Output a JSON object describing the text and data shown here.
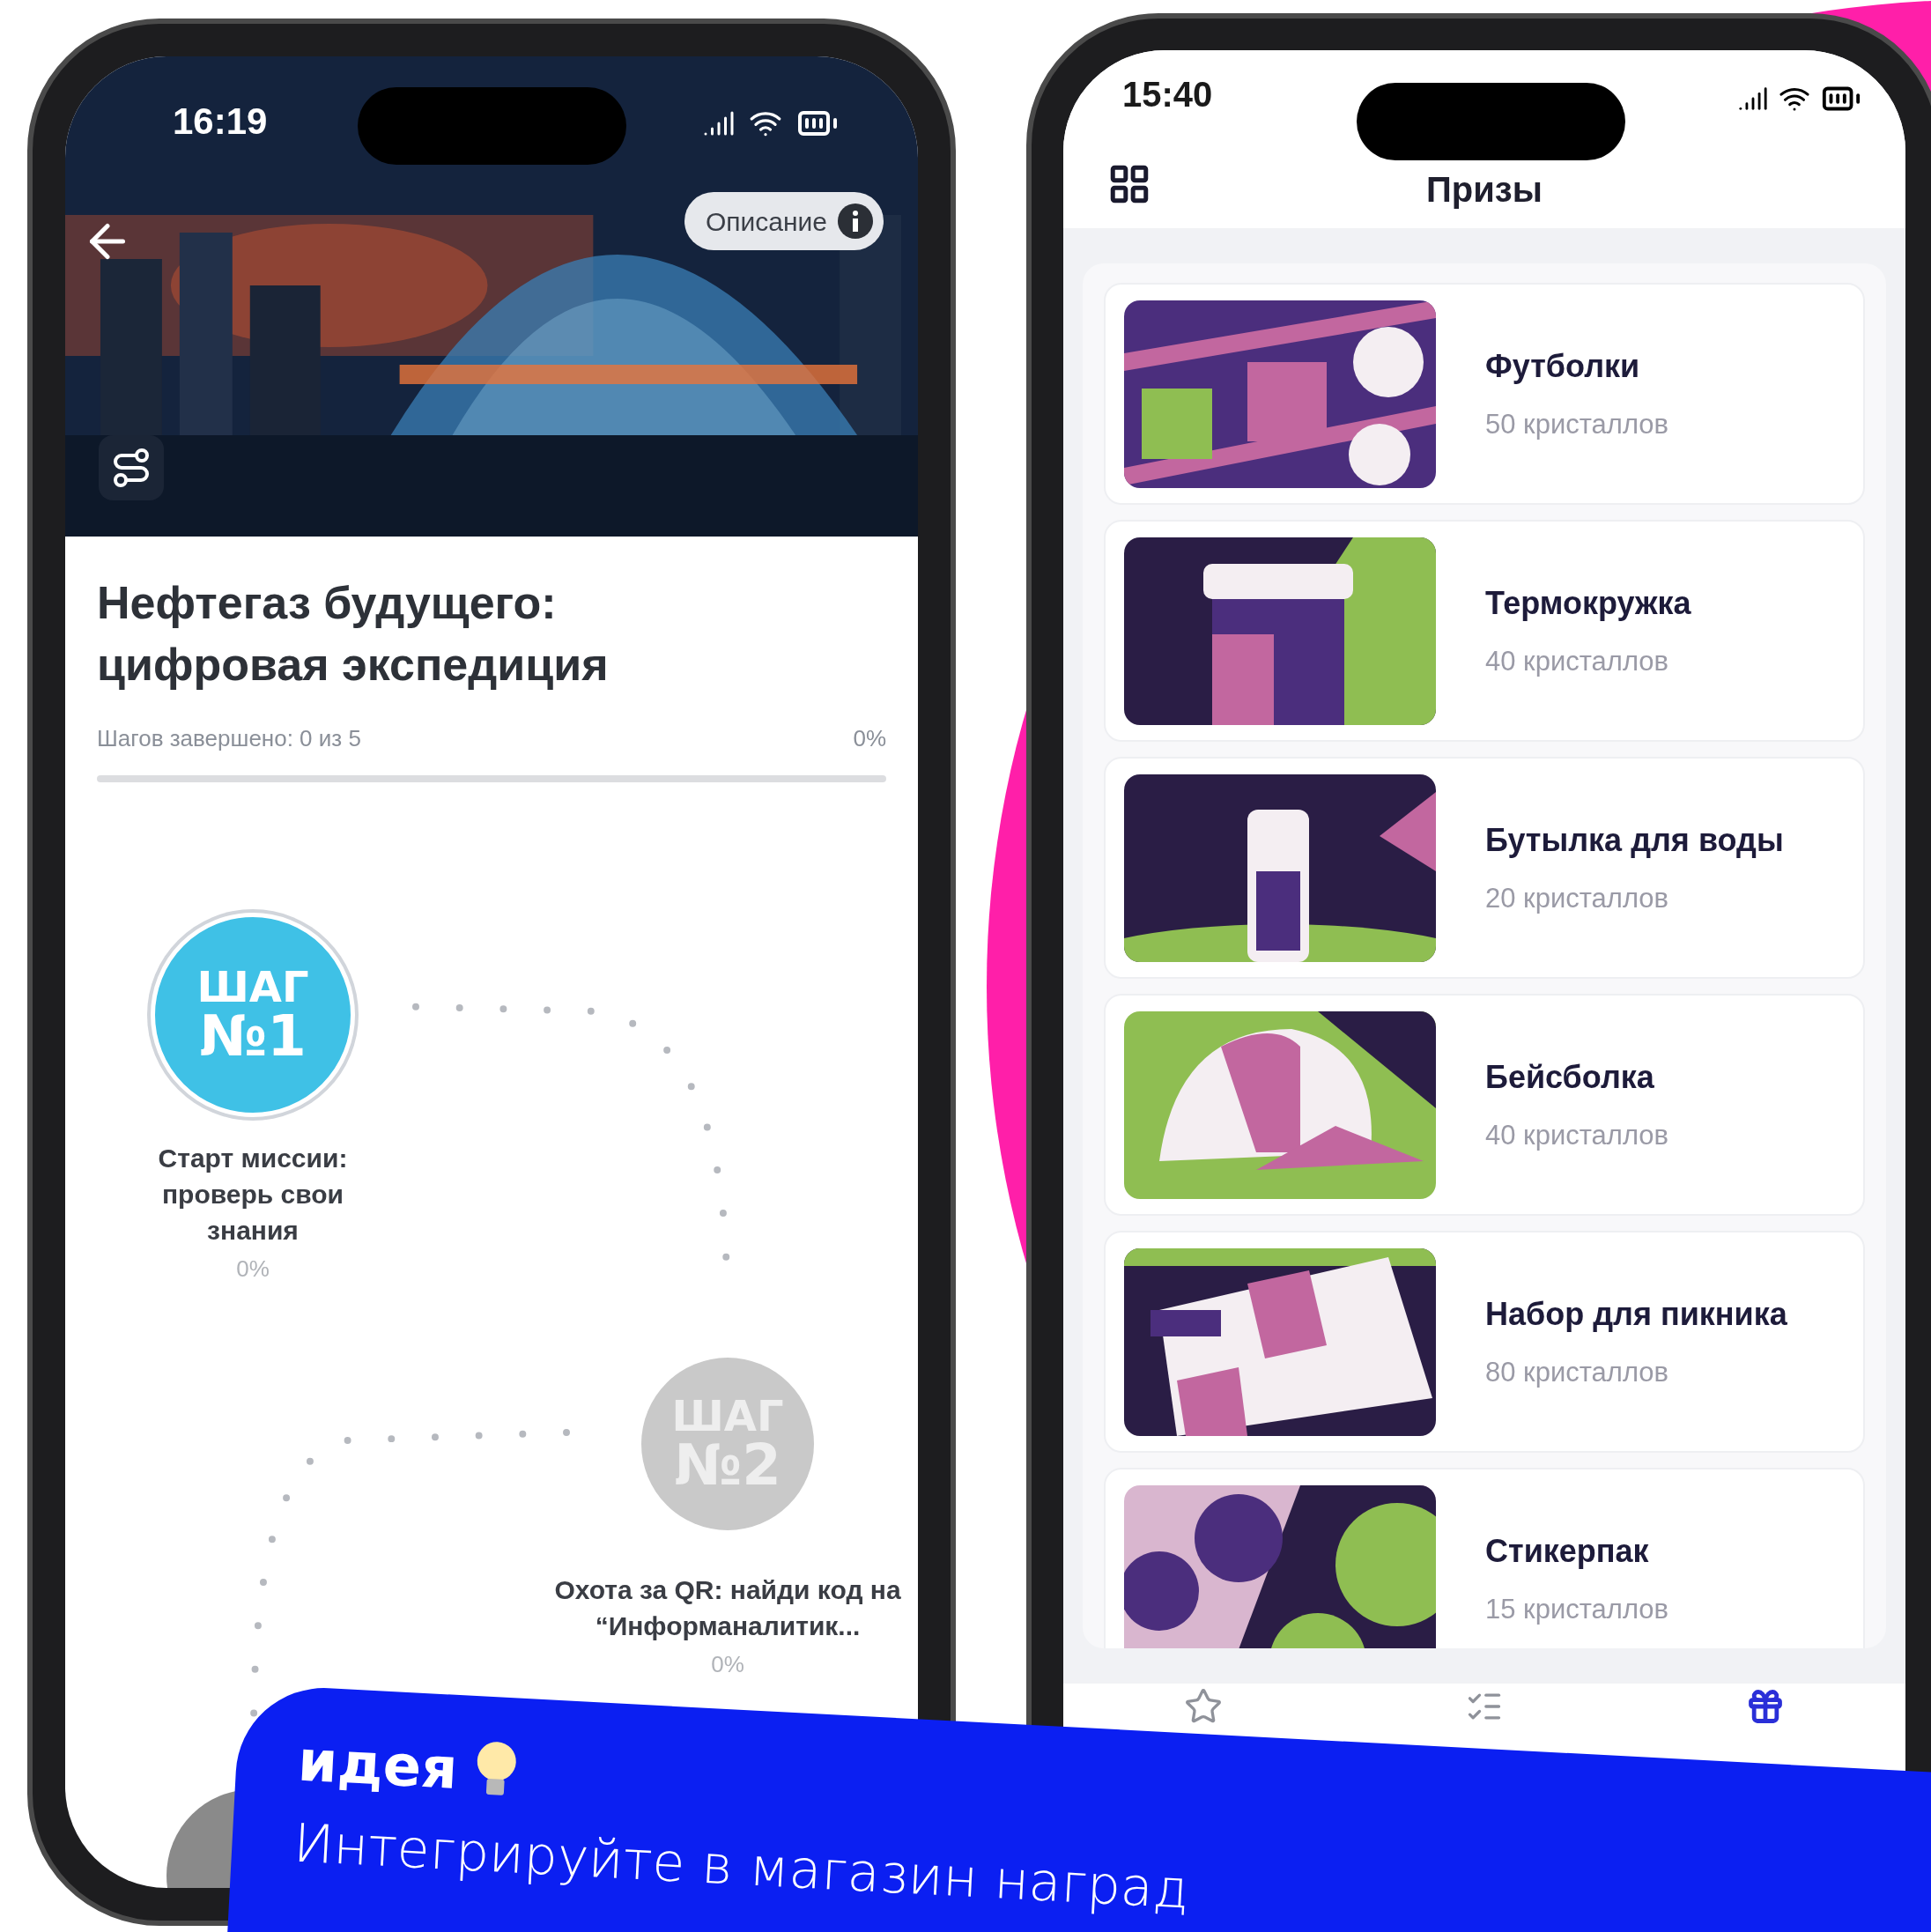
{
  "left_phone": {
    "status_bar": {
      "time": "16:19"
    },
    "description_button": "Описание",
    "title": "Нефтегаз будущего: цифровая экспедиция",
    "progress": {
      "label": "Шагов завершено: 0 из 5",
      "percent": "0%",
      "level": 0
    },
    "steps": [
      {
        "badge_top": "ШАГ",
        "badge_number": "№1",
        "title": "Старт миссии: проверь свои знания",
        "percent": "0%",
        "active": true
      },
      {
        "badge_top": "ШАГ",
        "badge_number": "№2",
        "title": "Охота за QR: найди код на “Информаналитик...",
        "percent": "0%",
        "active": false
      }
    ]
  },
  "right_phone": {
    "status_bar": {
      "time": "15:40"
    },
    "title": "Призы",
    "prizes": [
      {
        "name": "Футболки",
        "price": "50 кристаллов"
      },
      {
        "name": "Термокружка",
        "price": "40 кристаллов"
      },
      {
        "name": "Бутылка для воды",
        "price": "20 кристаллов"
      },
      {
        "name": "Бейсболка",
        "price": "40 кристаллов"
      },
      {
        "name": "Набор для пикника",
        "price": "80 кристаллов"
      },
      {
        "name": "Стикерпак",
        "price": "15 кристаллов"
      }
    ],
    "tab_bar": [
      {
        "kind": "star",
        "selected": false
      },
      {
        "kind": "checklist",
        "selected": false
      },
      {
        "kind": "gift",
        "selected": true
      }
    ]
  },
  "banner": {
    "heading": "идея",
    "text": "Интегрируйте в магазин наград"
  }
}
